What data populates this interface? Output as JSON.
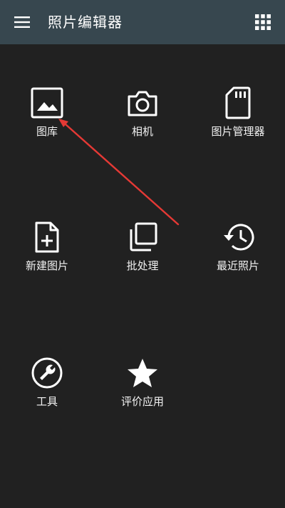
{
  "header": {
    "title": "照片编辑器",
    "menu_icon": "hamburger-menu-icon",
    "apps_icon": "apps-grid-icon"
  },
  "tiles": [
    {
      "label": "图库",
      "icon": "gallery-image-icon"
    },
    {
      "label": "相机",
      "icon": "camera-icon"
    },
    {
      "label": "图片管理器",
      "icon": "sd-card-icon"
    },
    {
      "label": "新建图片",
      "icon": "new-file-icon"
    },
    {
      "label": "批处理",
      "icon": "batch-layers-icon"
    },
    {
      "label": "最近照片",
      "icon": "history-icon"
    },
    {
      "label": "工具",
      "icon": "wrench-icon"
    },
    {
      "label": "评价应用",
      "icon": "star-icon"
    }
  ],
  "colors": {
    "appbar": "#37474f",
    "background": "#212121",
    "annotation_arrow": "#e53935"
  }
}
